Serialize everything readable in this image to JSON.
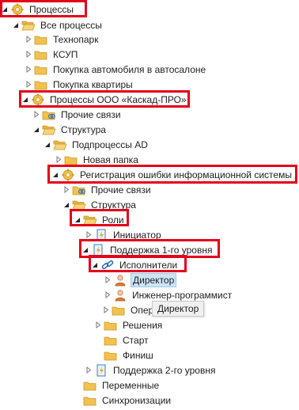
{
  "tree": {
    "nodes": [
      {
        "label": "Процессы",
        "icon": "process-gear-icon",
        "toggle": "expanded"
      },
      {
        "label": "Все процессы",
        "icon": "folder-open-icon",
        "toggle": "expanded"
      },
      {
        "label": "Технопарк",
        "icon": "folder-icon",
        "toggle": "collapsed"
      },
      {
        "label": "КСУП",
        "icon": "folder-icon",
        "toggle": "collapsed"
      },
      {
        "label": "Покупка автомобиля в автосалоне",
        "icon": "folder-icon",
        "toggle": "collapsed"
      },
      {
        "label": "Покупка квартиры",
        "icon": "folder-icon",
        "toggle": "collapsed"
      },
      {
        "label": "Процессы ООО «Каскад-ПРО»",
        "icon": "process-gear-icon",
        "toggle": "expanded"
      },
      {
        "label": "Прочие связи",
        "icon": "folder-link-icon",
        "toggle": "collapsed"
      },
      {
        "label": "Структура",
        "icon": "folder-open-icon",
        "toggle": "expanded"
      },
      {
        "label": "Подпроцессы AD",
        "icon": "folder-open-icon",
        "toggle": "expanded"
      },
      {
        "label": "Новая папка",
        "icon": "folder-icon",
        "toggle": "collapsed"
      },
      {
        "label": "Регистрация ошибки информационной системы",
        "icon": "process-gear-icon",
        "toggle": "expanded"
      },
      {
        "label": "Прочие связи",
        "icon": "folder-link-icon",
        "toggle": "collapsed"
      },
      {
        "label": "Структура",
        "icon": "folder-open-icon",
        "toggle": "expanded"
      },
      {
        "label": "Роли",
        "icon": "folder-open-icon",
        "toggle": "expanded"
      },
      {
        "label": "Инициатор",
        "icon": "role-doc-icon",
        "toggle": "collapsed"
      },
      {
        "label": "Поддержка 1-го уровня",
        "icon": "role-doc-icon",
        "toggle": "expanded"
      },
      {
        "label": "Исполнители",
        "icon": "link-chain-icon",
        "toggle": "expanded"
      },
      {
        "label": "Директор",
        "icon": "user-icon",
        "toggle": "collapsed"
      },
      {
        "label": "Инженер-программист",
        "icon": "user-icon",
        "toggle": "collapsed"
      },
      {
        "label": "Опера",
        "icon": "folder-icon",
        "toggle": "collapsed"
      },
      {
        "label": "Решения",
        "icon": "folder-icon",
        "toggle": "collapsed"
      },
      {
        "label": "Старт",
        "icon": "folder-icon",
        "toggle": "none"
      },
      {
        "label": "Финиш",
        "icon": "folder-icon",
        "toggle": "none"
      },
      {
        "label": "Поддержка 2-го уровня",
        "icon": "role-doc-icon",
        "toggle": "collapsed"
      },
      {
        "label": "Переменные",
        "icon": "folder-icon",
        "toggle": "none"
      },
      {
        "label": "Синхронизации",
        "icon": "folder-icon",
        "toggle": "none"
      }
    ]
  },
  "tooltip": {
    "text": "Директор"
  },
  "colors": {
    "highlight": "#e3001b",
    "selection": "#cce4f7",
    "folder": "#f2c14e"
  }
}
